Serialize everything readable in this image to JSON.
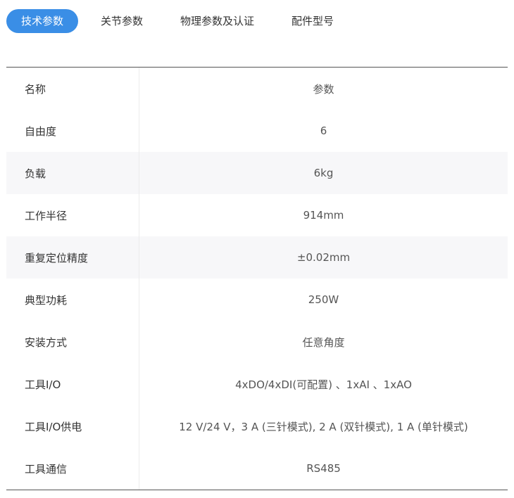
{
  "tabs": [
    {
      "label": "技术参数",
      "active": true
    },
    {
      "label": "关节参数",
      "active": false
    },
    {
      "label": "物理参数及认证",
      "active": false
    },
    {
      "label": "配件型号",
      "active": false
    }
  ],
  "colors": {
    "accent": "#3a8ee6",
    "row_shade": "#f7f7f9"
  },
  "table": {
    "header": {
      "name": "名称",
      "value": "参数"
    },
    "rows": [
      {
        "name": "自由度",
        "value": "6"
      },
      {
        "name": "负载",
        "value": "6kg"
      },
      {
        "name": "工作半径",
        "value": "914mm"
      },
      {
        "name": "重复定位精度",
        "value": "±0.02mm"
      },
      {
        "name": "典型功耗",
        "value": "250W"
      },
      {
        "name": "安装方式",
        "value": "任意角度"
      },
      {
        "name": "工具I/O",
        "value": "4xDO/4xDI(可配置) 、1xAI 、1xAO"
      },
      {
        "name": "工具I/O供电",
        "value": "12 V/24 V，3 A (三针模式), 2 A (双针模式), 1 A (单针模式)"
      },
      {
        "name": "工具通信",
        "value": "RS485"
      }
    ]
  }
}
